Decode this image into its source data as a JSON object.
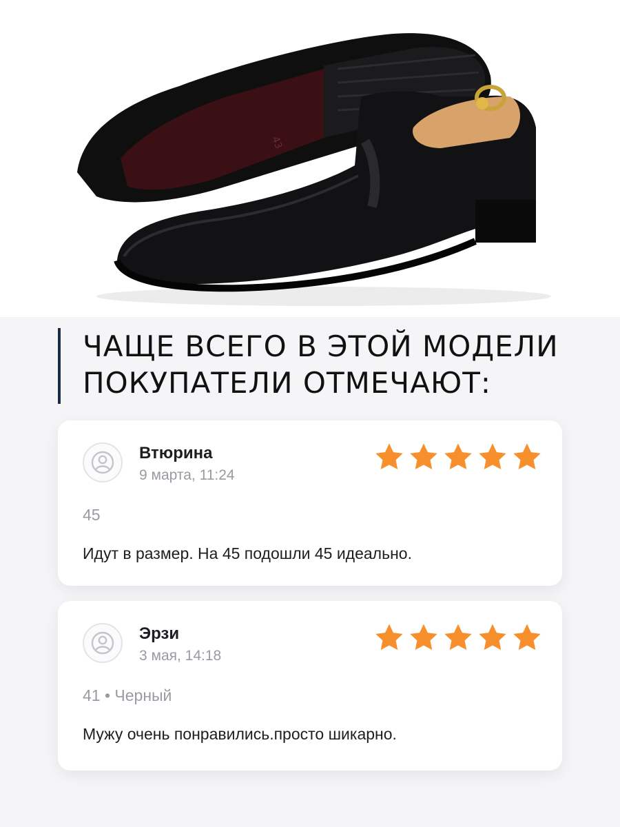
{
  "heading": {
    "line1": "ЧАЩЕ ВСЕГО В ЭТОЙ МОДЕЛИ",
    "line2": "ПОКУПАТЕЛИ ОТМЕЧАЮТ:"
  },
  "colors": {
    "accent_bar": "#1d2a44",
    "star": "#f7902c",
    "card_bg": "#ffffff",
    "muted_text": "#9a9aa2"
  },
  "reviews": [
    {
      "author": "Втюрина",
      "date": "9 марта, 11:24",
      "rating": 5,
      "meta": "45",
      "text": "Идут в размер. На 45 подошли 45 идеально.",
      "avatar_icon": "user-icon"
    },
    {
      "author": "Эрзи",
      "date": "3 мая, 14:18",
      "rating": 5,
      "meta": "41 • Черный",
      "text": "Мужу очень понравились.просто шикарно.",
      "avatar_icon": "user-icon"
    }
  ],
  "product_image": {
    "icon": "shoe-product-photo",
    "sole_stamp": "43"
  }
}
